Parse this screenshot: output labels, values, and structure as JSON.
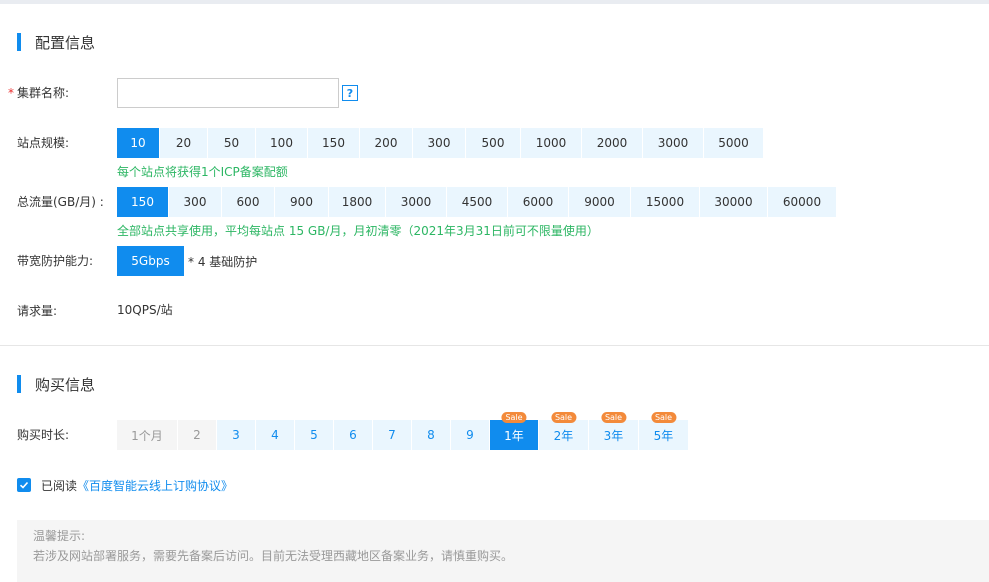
{
  "config": {
    "section_title": "配置信息",
    "cluster_name": {
      "label": "集群名称:",
      "required_mark": "*",
      "value": "",
      "placeholder": "",
      "help": "?"
    },
    "site_scale": {
      "label": "站点规模:",
      "options": [
        "10",
        "20",
        "50",
        "100",
        "150",
        "200",
        "300",
        "500",
        "1000",
        "2000",
        "3000",
        "5000"
      ],
      "selected": "10",
      "tip": "每个站点将获得1个ICP备案配额"
    },
    "traffic": {
      "label": "总流量(GB/月) :",
      "options": [
        "150",
        "300",
        "600",
        "900",
        "1800",
        "3000",
        "4500",
        "6000",
        "9000",
        "15000",
        "30000",
        "60000"
      ],
      "selected": "150",
      "tip": "全部站点共享使用，平均每站点 15 GB/月，月初清零（2021年3月31日前可不限量使用）"
    },
    "bandwidth": {
      "label": "带宽防护能力:",
      "option": "5Gbps",
      "note": "* 4 基础防护"
    },
    "requests": {
      "label": "请求量:",
      "value": "10QPS/站"
    }
  },
  "purchase": {
    "section_title": "购买信息",
    "duration": {
      "label": "购买时长:",
      "options": [
        {
          "label": "1个月",
          "state": "disabled"
        },
        {
          "label": "2",
          "state": "disabled"
        },
        {
          "label": "3",
          "state": "normal"
        },
        {
          "label": "4",
          "state": "normal"
        },
        {
          "label": "5",
          "state": "normal"
        },
        {
          "label": "6",
          "state": "normal"
        },
        {
          "label": "7",
          "state": "normal"
        },
        {
          "label": "8",
          "state": "normal"
        },
        {
          "label": "9",
          "state": "normal"
        },
        {
          "label": "1年",
          "state": "selected",
          "badge": "Sale"
        },
        {
          "label": "2年",
          "state": "normal",
          "badge": "Sale"
        },
        {
          "label": "3年",
          "state": "normal",
          "badge": "Sale"
        },
        {
          "label": "5年",
          "state": "normal",
          "badge": "Sale"
        }
      ]
    },
    "agreement": {
      "checked": true,
      "prefix": "已阅读",
      "link": "《百度智能云线上订购协议》"
    }
  },
  "notice": {
    "title": "温馨提示:",
    "body": "若涉及网站部署服务，需要先备案后访问。目前无法受理西藏地区备案业务，请慎重购买。"
  },
  "colors": {
    "accent": "#108cee",
    "tip": "#2cb663",
    "sale": "#f38a3a",
    "required": "#ea2e2e"
  }
}
